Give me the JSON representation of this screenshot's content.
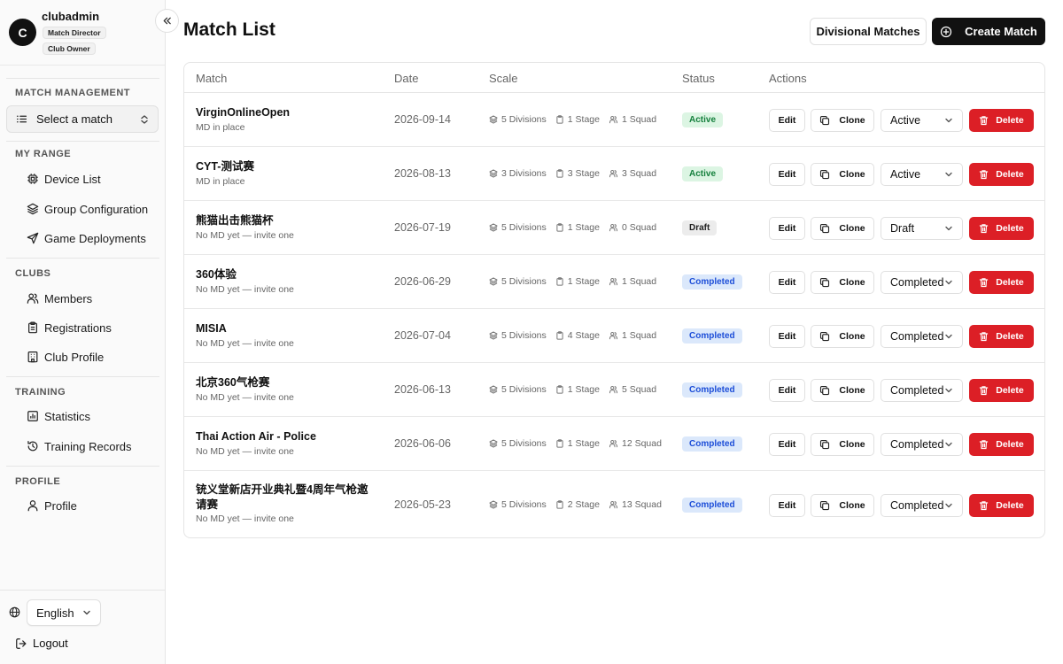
{
  "user": {
    "initial": "C",
    "name": "clubadmin",
    "roles": [
      "Match Director",
      "Club Owner"
    ]
  },
  "sidebar": {
    "match_management_title": "MATCH MANAGEMENT",
    "select_match": "Select a match",
    "my_range_title": "MY RANGE",
    "my_range_items": [
      {
        "label": "Device List",
        "icon": "chip-icon"
      },
      {
        "label": "Group Configuration",
        "icon": "layers-icon"
      },
      {
        "label": "Game Deployments",
        "icon": "send-icon"
      }
    ],
    "clubs_title": "CLUBS",
    "clubs_items": [
      {
        "label": "Members",
        "icon": "users-icon"
      },
      {
        "label": "Registrations",
        "icon": "clipboard-icon"
      },
      {
        "label": "Club Profile",
        "icon": "building-icon"
      }
    ],
    "training_title": "TRAINING",
    "training_items": [
      {
        "label": "Statistics",
        "icon": "chart-icon"
      },
      {
        "label": "Training Records",
        "icon": "history-icon"
      }
    ],
    "profile_title": "PROFILE",
    "profile_items": [
      {
        "label": "Profile",
        "icon": "user-icon"
      }
    ],
    "language": "English",
    "logout": "Logout"
  },
  "header": {
    "title": "Match List",
    "divisional_button": "Divisional Matches",
    "create_button": "Create Match"
  },
  "table": {
    "columns": [
      "Match",
      "Date",
      "Scale",
      "Status",
      "Actions"
    ],
    "actions": {
      "edit": "Edit",
      "clone": "Clone",
      "delete": "Delete"
    },
    "rows": [
      {
        "name": "VirginOnlineOpen",
        "sub": "MD in place",
        "date": "2026-09-14",
        "divisions": "5 Divisions",
        "stages": "1 Stage",
        "squads": "1 Squad",
        "status": "Active",
        "select": "Active"
      },
      {
        "name": "CYT-测试赛",
        "sub": "MD in place",
        "date": "2026-08-13",
        "divisions": "3 Divisions",
        "stages": "3 Stage",
        "squads": "3 Squad",
        "status": "Active",
        "select": "Active"
      },
      {
        "name": "熊猫出击熊猫杯",
        "sub": "No MD yet — invite one",
        "date": "2026-07-19",
        "divisions": "5 Divisions",
        "stages": "1 Stage",
        "squads": "0 Squad",
        "status": "Draft",
        "select": "Draft"
      },
      {
        "name": "360体验",
        "sub": "No MD yet — invite one",
        "date": "2026-06-29",
        "divisions": "5 Divisions",
        "stages": "1 Stage",
        "squads": "1 Squad",
        "status": "Completed",
        "select": "Completed"
      },
      {
        "name": "MISIA",
        "sub": "No MD yet — invite one",
        "date": "2026-07-04",
        "divisions": "5 Divisions",
        "stages": "4 Stage",
        "squads": "1 Squad",
        "status": "Completed",
        "select": "Completed"
      },
      {
        "name": "北京360气枪赛",
        "sub": "No MD yet — invite one",
        "date": "2026-06-13",
        "divisions": "5 Divisions",
        "stages": "1 Stage",
        "squads": "5 Squad",
        "status": "Completed",
        "select": "Completed"
      },
      {
        "name": "Thai Action Air - Police",
        "sub": "No MD yet — invite one",
        "date": "2026-06-06",
        "divisions": "5 Divisions",
        "stages": "1 Stage",
        "squads": "12 Squad",
        "status": "Completed",
        "select": "Completed"
      },
      {
        "name": "铳义堂新店开业典礼暨4周年气枪邀请赛",
        "sub": "No MD yet — invite one",
        "date": "2026-05-23",
        "divisions": "5 Divisions",
        "stages": "2 Stage",
        "squads": "13 Squad",
        "status": "Completed",
        "select": "Completed"
      }
    ]
  },
  "colors": {
    "accent_dark": "#111111",
    "delete_red": "#dc1f26",
    "active_green": "#15803d",
    "completed_blue": "#1d4ed8"
  }
}
